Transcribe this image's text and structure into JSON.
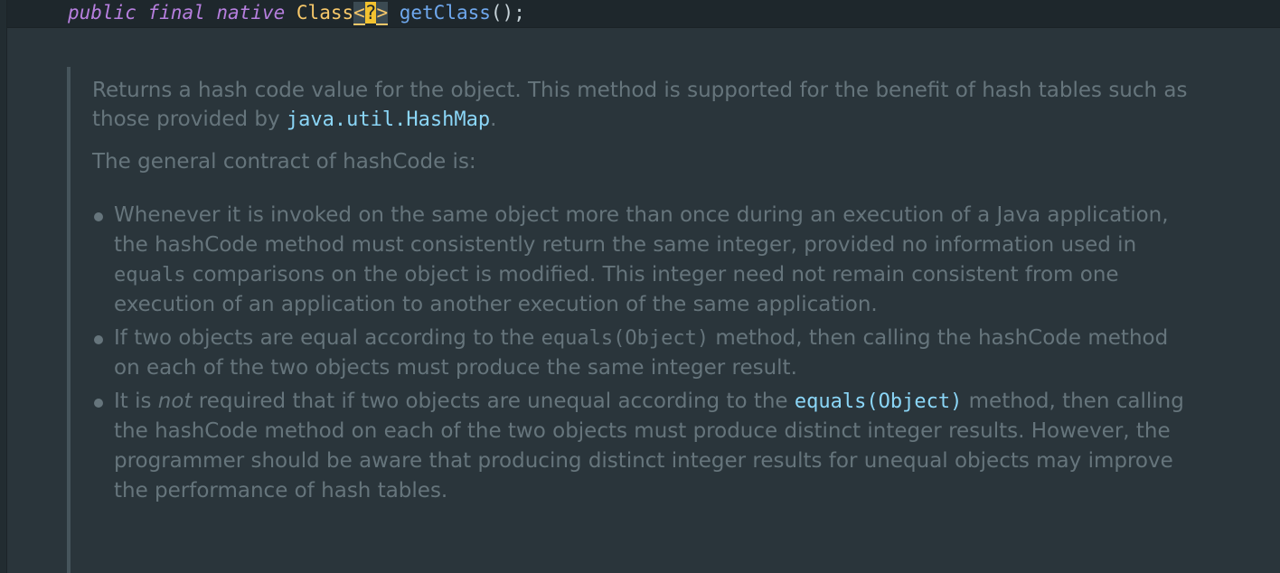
{
  "code": {
    "kw_public": "public",
    "kw_final": "final",
    "kw_native": "native",
    "type_name": "Class",
    "angle_open": "<",
    "wildcard": "?",
    "angle_close": ">",
    "method_name": "getClass",
    "trail": "();"
  },
  "doc": {
    "p1_text": "Returns a hash code value for the object. This method is supported for the benefit of hash tables such as those provided by ",
    "p1_link": "java.util.HashMap",
    "p1_end": ".",
    "p2_text": "The general contract of hashCode is:",
    "b1_a": "Whenever it is invoked on the same object more than once during an execution of a Java application, the ",
    "b1_code1": "hashCode",
    "b1_b": " method must consistently return the same integer, provided no information used in ",
    "b1_code2": "equals",
    "b1_c": " comparisons on the object is modified. This integer need not remain consistent from one execution of an application to another execution of the same application.",
    "b2_a": "If two objects are equal according to the ",
    "b2_code1": "equals(Object)",
    "b2_b": " method, then calling the ",
    "b2_code2": "hashCode",
    "b2_c": " method on each of the two objects must produce the same integer result.",
    "b3_a": "It is ",
    "b3_em": "not",
    "b3_b": " required that if two objects are unequal according to the ",
    "b3_link": "equals(Object)",
    "b3_c": " method, then calling the ",
    "b3_code": "hashCode",
    "b3_d": " method on each of the two objects must produce distinct integer results. However, the programmer should be aware that producing distinct integer results for unequal objects may improve the performance of hash tables."
  },
  "colors": {
    "background": "#2a353b",
    "keyword": "#b77fdf",
    "type": "#f7c86a",
    "method": "#6fa8ee",
    "link": "#8bd6f7",
    "doc_text": "#66757c"
  }
}
